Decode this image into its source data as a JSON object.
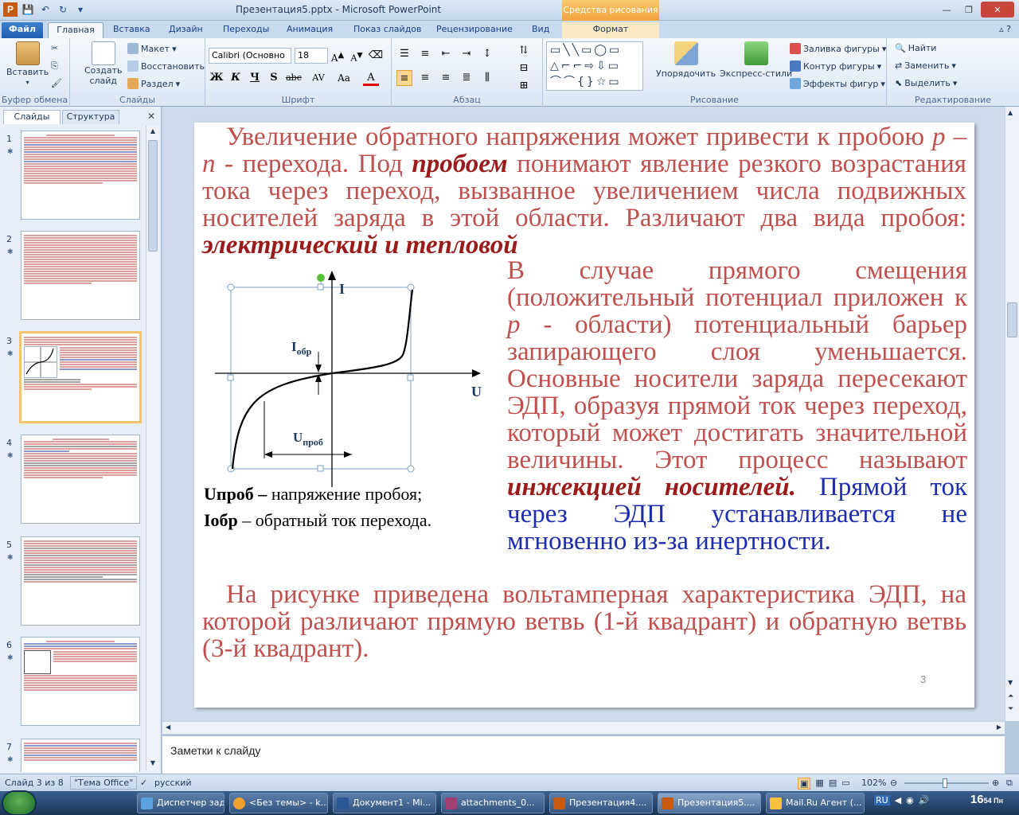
{
  "window": {
    "title": "Презентация5.pptx - Microsoft PowerPoint",
    "context_label": "Средства рисования"
  },
  "tabs": [
    "Файл",
    "Главная",
    "Вставка",
    "Дизайн",
    "Переходы",
    "Анимация",
    "Показ слайдов",
    "Рецензирование",
    "Вид",
    "Формат"
  ],
  "ribbon": {
    "clipboard": {
      "label": "Буфер обмена",
      "paste": "Вставить"
    },
    "slides": {
      "label": "Слайды",
      "new_slide_1": "Создать",
      "new_slide_2": "слайд",
      "layout": "Макет",
      "reset": "Восстановить",
      "section": "Раздел"
    },
    "font": {
      "label": "Шрифт",
      "name": "Calibri (Основно",
      "size": "18",
      "bold": "Ж",
      "italic": "К",
      "underline": "Ч",
      "strike": "abc",
      "spacing": "AV",
      "case": "Aa"
    },
    "paragraph": {
      "label": "Абзац"
    },
    "drawing": {
      "label": "Рисование",
      "arrange": "Упорядочить",
      "quick_styles": "Экспресс-стили",
      "fill": "Заливка фигуры",
      "outline": "Контур фигуры",
      "effects": "Эффекты фигур"
    },
    "editing": {
      "label": "Редактирование",
      "find": "Найти",
      "replace": "Заменить",
      "select": "Выделить"
    }
  },
  "left_panel": {
    "tab_slides": "Слайды",
    "tab_outline": "Структура",
    "close": "✕",
    "thumbnails": [
      "1",
      "2",
      "3",
      "4",
      "5",
      "6",
      "7"
    ],
    "selected": "3"
  },
  "slide": {
    "para1": {
      "t1": "Увеличение обратного напряжения может привести к пробою ",
      "pn": "р – п",
      "t2": " - перехода. Под ",
      "breakdown": "пробоем",
      "t3": " понимают явление резкого возрастания тока через переход, вызванное увеличением числа подвижных носителей заряда в этой области. Различают два вида пробоя: ",
      "types": "электрический и тепловой"
    },
    "para2": {
      "t1": "В случае прямого смещения (положительный потенциал приложен к ",
      "p": "р",
      "t2": " - области) потенциальный барьер запирающего слоя уменьшается. Основные носители заряда пересекают ЭДП, образуя прямой ток через переход, который может достигать значительной величины. Этот процесс называют ",
      "injection": "инжекцией носителей.",
      "t3": " Прямой ток через ЭДП устанавливается не мгновенно из-за инертности."
    },
    "para3": "На рисунке приведена вольтамперная характеристика ЭДП, на которой различают прямую ветвь (1-й квадрант) и обратную ветвь (3-й квадрант).",
    "figure": {
      "axis_i": "I",
      "axis_u": "U",
      "i_label": "I",
      "i_sub": "обр",
      "u_label": "U",
      "u_sub": "проб"
    },
    "caption1_b": "Uпроб –",
    "caption1": " напряжение пробоя;",
    "caption2_b": "Iобр",
    "caption2": " – обратный ток перехода.",
    "number": "3"
  },
  "notes": "Заметки к слайду",
  "status": {
    "slide": "Слайд 3 из 8",
    "theme": "\"Тема Office\"",
    "lang": "русский",
    "zoom": "102%"
  },
  "taskbar": {
    "items": [
      "Диспетчер зад...",
      "<Без темы> - k...",
      "Документ1 - Mi...",
      "attachments_0...",
      "Презентация4....",
      "Презентация5....",
      "Mail.Ru Агент (..."
    ],
    "lang": "RU",
    "time": "16",
    "time_min": "54",
    "day": "Пн"
  },
  "colors": {
    "slide_text": "#c0504d",
    "emphasis": "#9b1b1b",
    "blue_text": "#1d2db0"
  }
}
